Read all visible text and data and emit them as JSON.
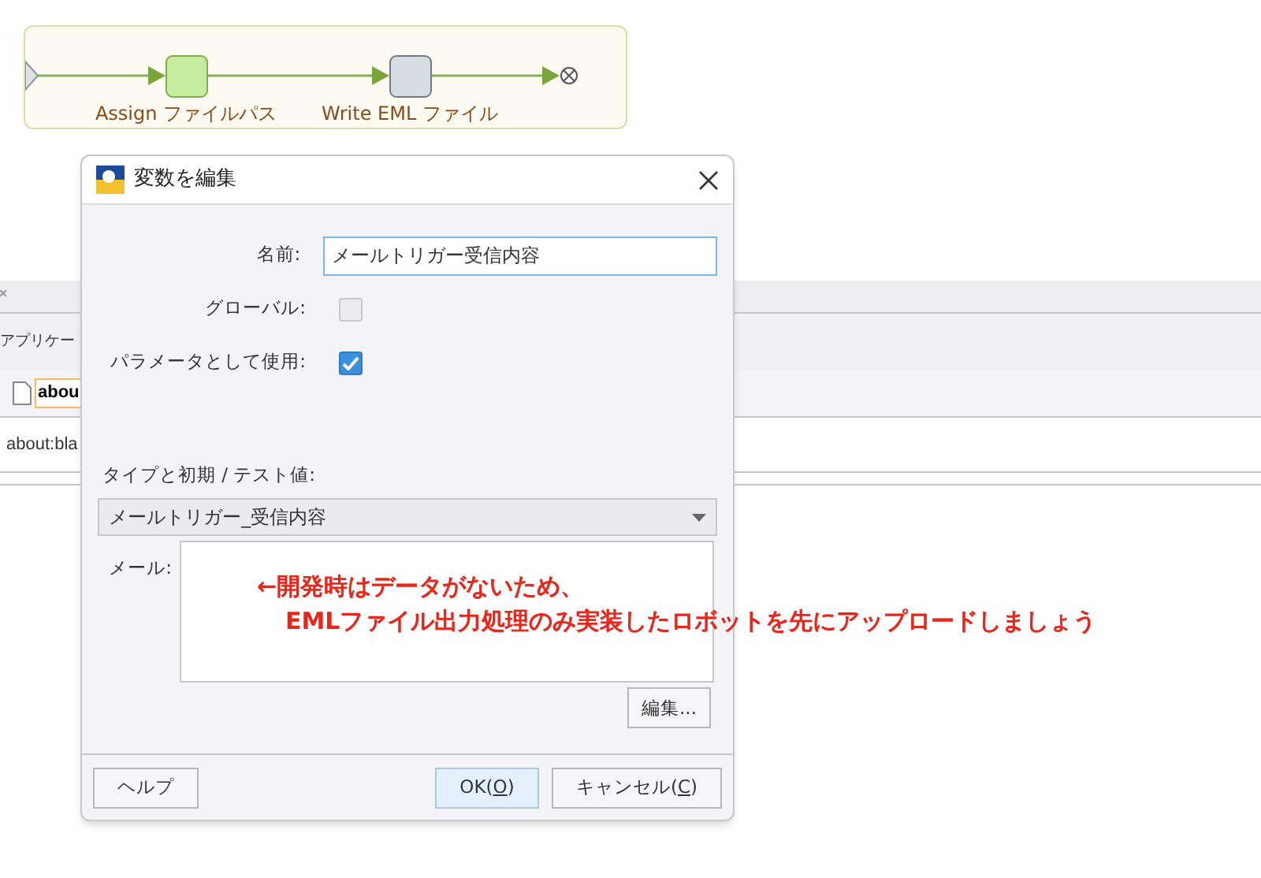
{
  "diagram": {
    "nodes": [
      {
        "label": "Assign ファイルパス",
        "kind": "assign"
      },
      {
        "label": "Write EML ファイル",
        "kind": "write"
      }
    ]
  },
  "background": {
    "section_label": "アプリケー",
    "tab": {
      "label": "abou",
      "selected": true
    },
    "address": "about:bla"
  },
  "dialog": {
    "title": "変数を編集",
    "fields": [
      {
        "kind": "text",
        "label": "名前:",
        "value": "メールトリガー受信内容"
      },
      {
        "kind": "checkbox",
        "label": "グローバル:",
        "checked": false,
        "disabled": true
      },
      {
        "kind": "checkbox",
        "label": "パラメータとして使用:",
        "checked": true,
        "disabled": false
      }
    ],
    "type_label": "タイプと初期 / テスト値:",
    "type_select": "メールトリガー_受信内容",
    "mail_label": "メール:",
    "edit_button": "編集...",
    "buttons": [
      {
        "prefix": "ヘルプ",
        "default": false
      },
      {
        "prefix": "OK(",
        "mnemonic": "O",
        "suffix": ")",
        "default": true
      },
      {
        "prefix": "キャンセル(",
        "mnemonic": "C",
        "suffix": ")",
        "default": false
      }
    ]
  },
  "annotation": {
    "lines": [
      "←開発時はデータがないため、",
      "EMLファイル出力処理のみ実装したロボットを先にアップロードしましょう"
    ]
  }
}
